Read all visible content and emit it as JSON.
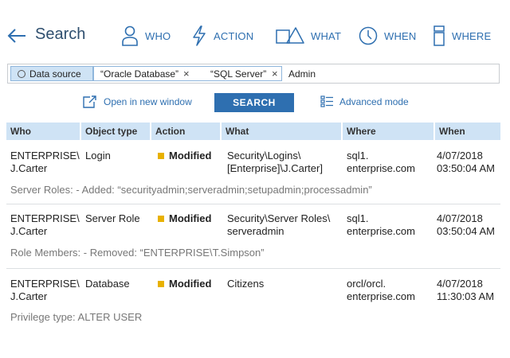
{
  "header": {
    "back_icon": "arrow-left-icon",
    "title": "Search",
    "nav": [
      {
        "label": "WHO",
        "icon": "user-icon"
      },
      {
        "label": "ACTION",
        "icon": "lightning-icon"
      },
      {
        "label": "WHAT",
        "icon": "object-shapes-icon"
      },
      {
        "label": "WHEN",
        "icon": "clock-icon"
      },
      {
        "label": "WHERE",
        "icon": "server-icon"
      }
    ]
  },
  "search": {
    "filter_label": "Data source",
    "values": [
      "“Oracle Database”",
      "“SQL Server”"
    ],
    "remove_symbol": "×",
    "text": "Admin"
  },
  "actions": {
    "open_new_window": "Open in new window",
    "search_button": "SEARCH",
    "advanced_mode": "Advanced mode"
  },
  "table": {
    "columns": [
      "Who",
      "Object type",
      "Action",
      "What",
      "Where",
      "When"
    ],
    "rows": [
      {
        "who": "ENTERPRISE\\\nJ.Carter",
        "object_type": "Login",
        "action": "Modified",
        "what": "Security\\Logins\\\n[Enterprise]\\J.Carter]",
        "where": "sql1.\nenterprise.com",
        "when": "4/07/2018\n03:50:04 AM",
        "detail": "Server Roles:  - Added: “securityadmin;serveradmin;setupadmin;processadmin”"
      },
      {
        "who": "ENTERPRISE\\\nJ.Carter",
        "object_type": "Server Role",
        "action": "Modified",
        "what": "Security\\Server Roles\\\nserveradmin",
        "where": "sql1.\nenterprise.com",
        "when": "4/07/2018\n03:50:04 AM",
        "detail": "Role Members:  - Removed: “ENTERPRISE\\T.Simpson”"
      },
      {
        "who": "ENTERPRISE\\\nJ.Carter",
        "object_type": "Database",
        "action": "Modified",
        "what": "Citizens",
        "where": "orcl/orcl.\nenterprise.com",
        "when": "4/07/2018\n11:30:03 AM",
        "detail": "Privilege type: ALTER USER"
      }
    ],
    "action_color": "#e8b100"
  },
  "colors": {
    "accent": "#2e6fb0",
    "header_bg": "#cfe3f5"
  }
}
